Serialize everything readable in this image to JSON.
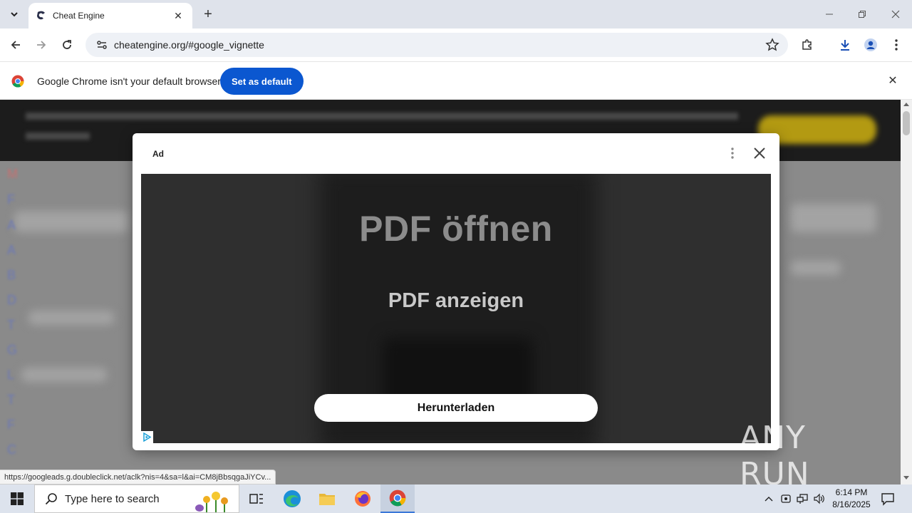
{
  "browser": {
    "tab": {
      "title": "Cheat Engine"
    },
    "address": {
      "url": "cheatengine.org/#google_vignette"
    },
    "infobar": {
      "message": "Google Chrome isn't your default browser",
      "button": "Set as default"
    },
    "status_url": "https://googleads.g.doubleclick.net/aclk?nis=4&sa=l&ai=CM8jBbsqgaJiYCv..."
  },
  "ad": {
    "label": "Ad",
    "headline": "PDF öffnen",
    "subheadline": "PDF anzeigen",
    "cta": "Herunterladen"
  },
  "watermark": "ANY RUN",
  "taskbar": {
    "search_placeholder": "Type here to search",
    "time": "6:14 PM",
    "date": "8/16/2025"
  },
  "colors": {
    "accent": "#0b57d0",
    "ad_background": "#2f2f2f",
    "taskbar": "#dde3ed"
  }
}
